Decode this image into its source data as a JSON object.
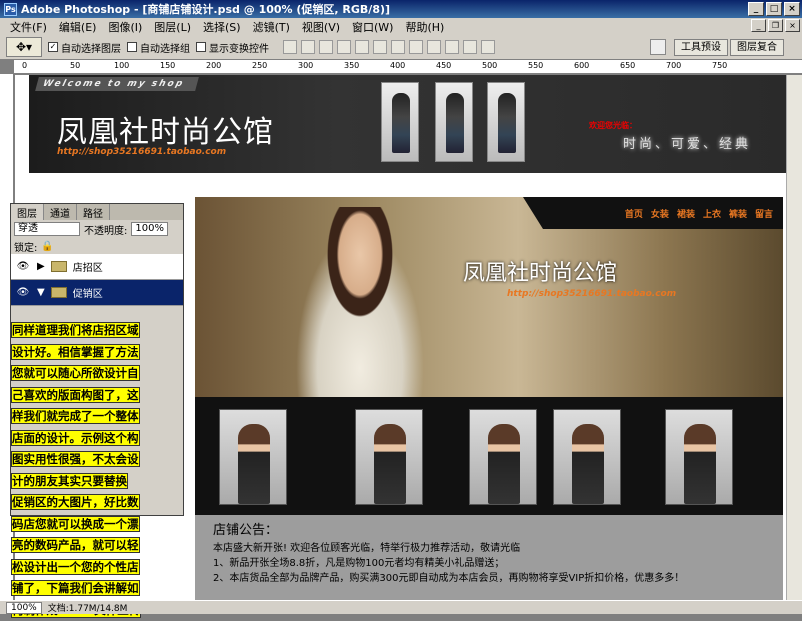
{
  "window": {
    "title": "Adobe Photoshop - [商铺店铺设计.psd @ 100% (促销区, RGB/8)]"
  },
  "menu": [
    "文件(F)",
    "编辑(E)",
    "图像(I)",
    "图层(L)",
    "选择(S)",
    "滤镜(T)",
    "视图(V)",
    "窗口(W)",
    "帮助(H)"
  ],
  "options": {
    "auto_select": "自动选择图层",
    "auto_select_group": "自动选择组",
    "show_transform": "显示变换控件",
    "workspace1": "工具预设",
    "workspace2": "图层复合"
  },
  "ruler": [
    "0",
    "50",
    "100",
    "150",
    "200",
    "250",
    "300",
    "350",
    "400",
    "450",
    "500",
    "550",
    "600",
    "650",
    "700",
    "750"
  ],
  "design": {
    "welcome": "Welcome to my shop",
    "logo": "凤凰社时尚公馆",
    "url": "http://shop35216691.taobao.com",
    "welcome_red": "欢迎您光临：",
    "slogan": "时尚、可爱、经典",
    "nav": [
      "首页",
      "女装",
      "裙装",
      "上衣",
      "裤装",
      "留言"
    ],
    "hero_logo": "凤凰社时尚公馆",
    "hero_url": "http://shop35216691.taobao.com",
    "notice_title": "店铺公告：",
    "notice_lines": [
      "本店盛大新开张! 欢迎各位顾客光临，特举行极力推荐活动，敬请光临",
      "1、新品开张全场8.8折，凡是购物100元者均有精美小礼品赠送；",
      "2、本店货品全部为品牌产品，购买满300元即自动成为本店会员，再购物将享受VIP折扣价格，优惠多多！"
    ]
  },
  "layers_panel": {
    "tabs": [
      "图层",
      "通道",
      "路径"
    ],
    "blend": "穿透",
    "opacity_label": "不透明度:",
    "opacity": "100%",
    "lock_label": "锁定:",
    "layers": [
      {
        "name": "店招区",
        "selected": false
      },
      {
        "name": "促销区",
        "selected": true
      }
    ]
  },
  "overlay_text": [
    "同样道理我们将店招区域",
    "设计好。相信掌握了方法",
    "您就可以随心所欲设计自",
    "己喜欢的版面构图了，这",
    "样我们就完成了一个整体",
    "店面的设计。示例这个构",
    "图实用性很强，不太会设",
    "计的朋友其实只要替换",
    "促销区的大图片，好比数",
    "码店您就可以换成一个漂",
    "亮的数码产品，就可以轻",
    "松设计出一个您的个性店",
    "铺了，下篇我们会讲解如",
    "何制作成HTML文件上传"
  ],
  "status": {
    "zoom": "100%",
    "doc": "文档:1.77M/14.8M"
  }
}
